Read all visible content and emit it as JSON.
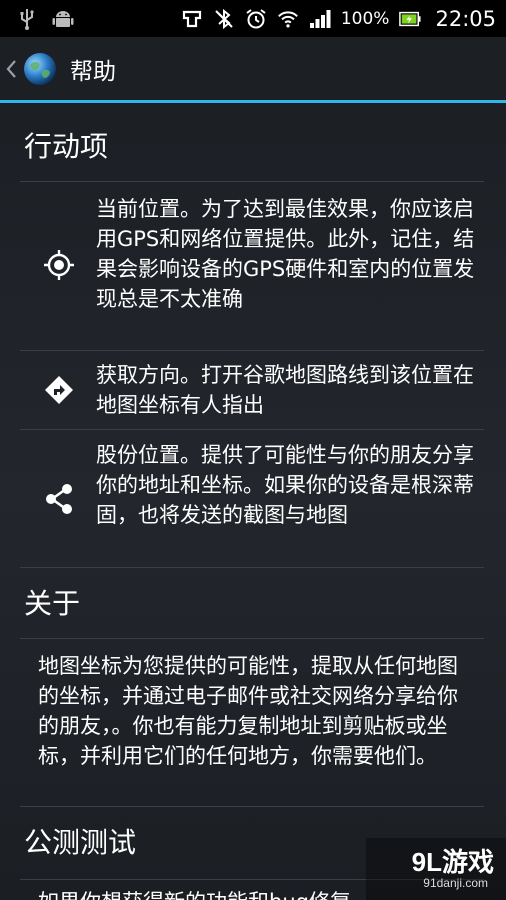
{
  "status_bar": {
    "battery": "100%",
    "time": "22:05"
  },
  "action_bar": {
    "title": "帮助"
  },
  "actions": {
    "heading": "行动项",
    "items": [
      {
        "icon": "crosshair-icon",
        "text": "当前位置。为了达到最佳效果，你应该启用GPS和网络位置提供。此外，记住，结果会影响设备的GPS硬件和室内的位置发现总是不太准确"
      },
      {
        "icon": "directions-icon",
        "text": "获取方向。打开谷歌地图路线到该位置在地图坐标有人指出"
      },
      {
        "icon": "share-icon",
        "text": "股份位置。提供了可能性与你的朋友分享你的地址和坐标。如果你的设备是根深蒂固，也将发送的截图与地图"
      }
    ]
  },
  "about": {
    "heading": "关于",
    "text": "地图坐标为您提供的可能性，提取从任何地图的坐标，并通过电子邮件或社交网络分享给你的朋友，。你也有能力复制地址到剪贴板或坐标，并利用它们的任何地方，你需要他们。"
  },
  "beta": {
    "heading": "公测测试",
    "text": "如果你想获得新的功能和bug修复"
  },
  "watermark": {
    "logo": "9L游戏",
    "site": "91danji.com"
  }
}
